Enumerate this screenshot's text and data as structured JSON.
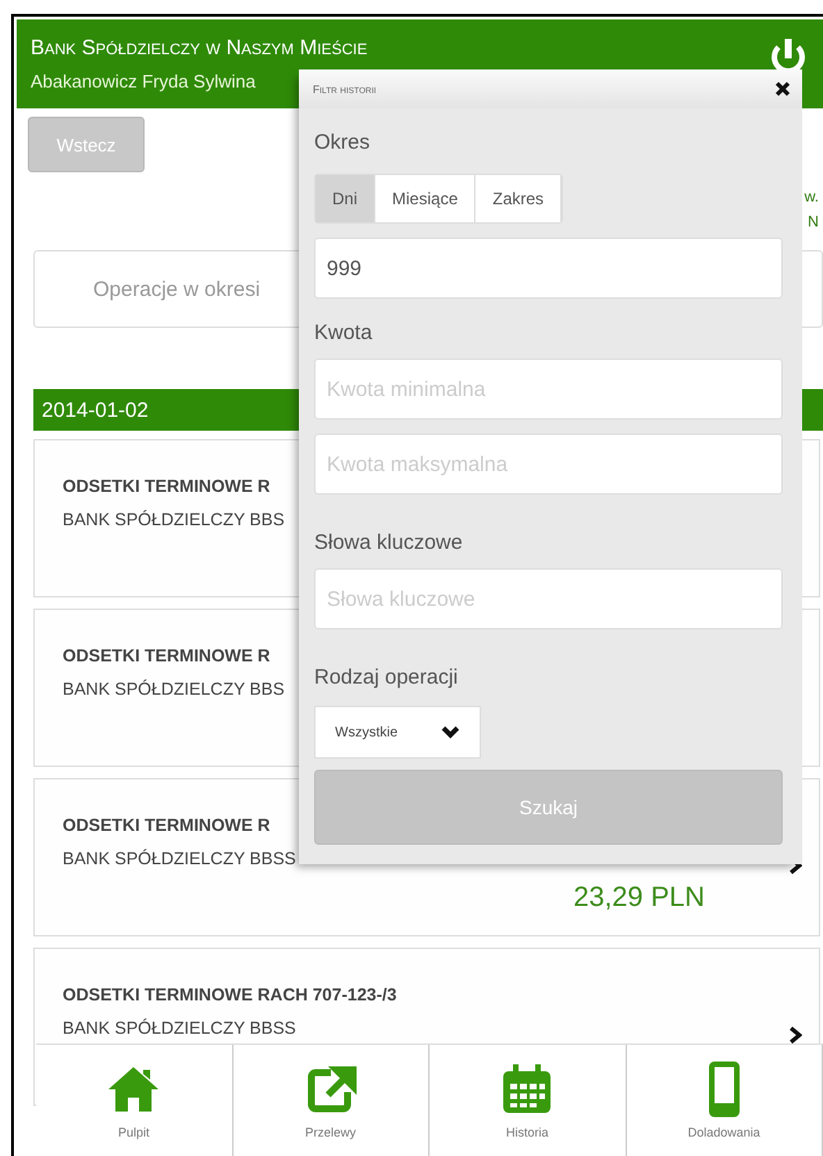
{
  "header": {
    "bank_name": "Bank Spółdzielczy w Naszym Mieście",
    "user_name": "Abakanowicz Fryda Sylwina"
  },
  "toolbar": {
    "back_button": "Wstecz",
    "side_texts": [
      "w.",
      "N"
    ]
  },
  "period_field": {
    "text": "Operacje w okresi"
  },
  "date_group": {
    "date": "2014-01-02"
  },
  "operations": [
    {
      "title": "ODSETKI TERMINOWE R",
      "subtitle": "BANK SPÓŁDZIELCZY BBS"
    },
    {
      "title": "ODSETKI TERMINOWE R",
      "subtitle": "BANK SPÓŁDZIELCZY BBS"
    },
    {
      "title": "ODSETKI TERMINOWE R",
      "subtitle": "BANK SPÓŁDZIELCZY BBSS",
      "amount": "23,29 PLN",
      "chevron": true
    },
    {
      "title": "ODSETKI TERMINOWE RACH 707-123-/3",
      "subtitle": "BANK SPÓŁDZIELCZY BBSS",
      "chevron": true
    }
  ],
  "filter_dialog": {
    "title": "Filtr historii",
    "period_label": "Okres",
    "period_tabs": [
      {
        "label": "Dni",
        "selected": true
      },
      {
        "label": "Miesiące",
        "selected": false
      },
      {
        "label": "Zakres",
        "selected": false
      }
    ],
    "days_value": "999",
    "amount_label": "Kwota",
    "amount_min": {
      "placeholder": "Kwota minimalna"
    },
    "amount_max": {
      "placeholder": "Kwota maksymalna"
    },
    "keywords_label": "Słowa kluczowe",
    "keywords": {
      "placeholder": "Słowa kluczowe"
    },
    "type_label": "Rodzaj operacji",
    "type_select": "Wszystkie",
    "search_button": "Szukaj"
  },
  "footer_nav": [
    {
      "label": "Pulpit",
      "kind": "home"
    },
    {
      "label": "Przelewy",
      "kind": "transfer"
    },
    {
      "label": "Historia",
      "kind": "calendar"
    },
    {
      "label": "Doladowania",
      "kind": "phone"
    }
  ]
}
